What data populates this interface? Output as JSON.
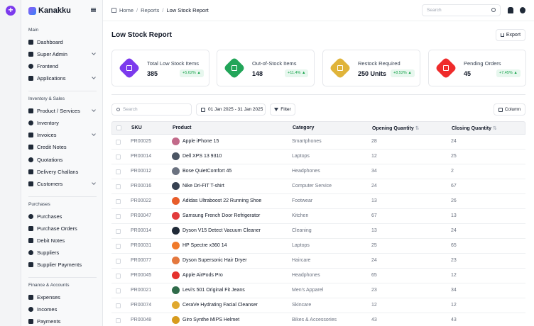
{
  "brand": {
    "name": "Kanakku"
  },
  "sidebar": {
    "sections": [
      {
        "title": "Main",
        "items": [
          {
            "label": "Dashboard",
            "chevron": false
          },
          {
            "label": "Super Admin",
            "chevron": true
          },
          {
            "label": "Frontend",
            "chevron": false
          },
          {
            "label": "Applications",
            "chevron": true
          }
        ]
      },
      {
        "title": "Inventory & Sales",
        "items": [
          {
            "label": "Product / Services",
            "chevron": true
          },
          {
            "label": "Inventory",
            "chevron": false
          },
          {
            "label": "Invoices",
            "chevron": true
          },
          {
            "label": "Credit Notes",
            "chevron": false
          },
          {
            "label": "Quotations",
            "chevron": false
          },
          {
            "label": "Delivery Challans",
            "chevron": false
          },
          {
            "label": "Customers",
            "chevron": true
          }
        ]
      },
      {
        "title": "Purchases",
        "items": [
          {
            "label": "Purchases",
            "chevron": false
          },
          {
            "label": "Purchase Orders",
            "chevron": false
          },
          {
            "label": "Debit Notes",
            "chevron": false
          },
          {
            "label": "Suppliers",
            "chevron": false
          },
          {
            "label": "Supplier Payments",
            "chevron": false
          }
        ]
      },
      {
        "title": "Finance & Accounts",
        "items": [
          {
            "label": "Expenses",
            "chevron": false
          },
          {
            "label": "Incomes",
            "chevron": false
          },
          {
            "label": "Payments",
            "chevron": false
          }
        ]
      }
    ]
  },
  "topbar": {
    "breadcrumb": [
      "Home",
      "Reports",
      "Low Stock Report"
    ],
    "search_placeholder": "Search"
  },
  "page": {
    "title": "Low Stock Report",
    "export_label": "Export"
  },
  "cards": [
    {
      "label": "Total Low Stock Items",
      "value": "385",
      "badge": "+5.62%",
      "color": "#7c3aed"
    },
    {
      "label": "Out-of-Stock Items",
      "value": "148",
      "badge": "+11.4%",
      "color": "#22a559"
    },
    {
      "label": "Restock Required",
      "value": "250 Units",
      "badge": "+8.52%",
      "color": "#e0b43a"
    },
    {
      "label": "Pending Orders",
      "value": "45",
      "badge": "+7.45%",
      "color": "#ef2b2b"
    }
  ],
  "filters": {
    "search_placeholder": "Search",
    "date_range": "01 Jan 2025 - 31 Jan 2025",
    "filter_label": "Filter",
    "column_label": "Column"
  },
  "table": {
    "headers": {
      "sku": "SKU",
      "product": "Product",
      "category": "Category",
      "opening": "Opening Quantity",
      "closing": "Closing Quantity"
    },
    "rows": [
      {
        "sku": "PR00025",
        "product": "Apple iPhone 15",
        "category": "Smartphones",
        "opening": "28",
        "closing": "24",
        "thumb": "#c26a8a"
      },
      {
        "sku": "PR00014",
        "product": "Dell XPS 13 9310",
        "category": "Laptops",
        "opening": "12",
        "closing": "25",
        "thumb": "#4b5563"
      },
      {
        "sku": "PR00012",
        "product": "Bose QuietComfort 45",
        "category": "Headphones",
        "opening": "34",
        "closing": "2",
        "thumb": "#6b7280"
      },
      {
        "sku": "PR00016",
        "product": "Nike Dri-FIT T-shirt",
        "category": "Computer Service",
        "opening": "24",
        "closing": "67",
        "thumb": "#374151"
      },
      {
        "sku": "PR00022",
        "product": "Adidas Ultraboost 22 Running Shoe",
        "category": "Footwear",
        "opening": "13",
        "closing": "26",
        "thumb": "#e85d2a"
      },
      {
        "sku": "PR00047",
        "product": "Samsung French Door Refrigerator",
        "category": "Kitchen",
        "opening": "67",
        "closing": "13",
        "thumb": "#e23b3b"
      },
      {
        "sku": "PR00014",
        "product": "Dyson V15 Detect  Vacuum Cleaner",
        "category": "Cleaning",
        "opening": "13",
        "closing": "24",
        "thumb": "#1f2937"
      },
      {
        "sku": "PR00031",
        "product": "HP Spectre x360 14",
        "category": "Laptops",
        "opening": "25",
        "closing": "65",
        "thumb": "#f07a2a"
      },
      {
        "sku": "PR00077",
        "product": "Dyson Supersonic Hair Dryer",
        "category": "Haircare",
        "opening": "24",
        "closing": "23",
        "thumb": "#e4783e"
      },
      {
        "sku": "PR00045",
        "product": "Apple AirPods Pro",
        "category": "Headphones",
        "opening": "65",
        "closing": "12",
        "thumb": "#e5322d"
      },
      {
        "sku": "PR00021",
        "product": "Levi's 501 Original Fit Jeans",
        "category": "Men's Apparel",
        "opening": "23",
        "closing": "34",
        "thumb": "#2f6b4a"
      },
      {
        "sku": "PR00074",
        "product": "CeraVe Hydrating Facial Cleanser",
        "category": "Skincare",
        "opening": "12",
        "closing": "12",
        "thumb": "#e0a82e"
      },
      {
        "sku": "PR00048",
        "product": "Giro Synthe MIPS Helmet",
        "category": "Bikes & Accessories",
        "opening": "43",
        "closing": "43",
        "thumb": "#d79b1e"
      }
    ]
  }
}
